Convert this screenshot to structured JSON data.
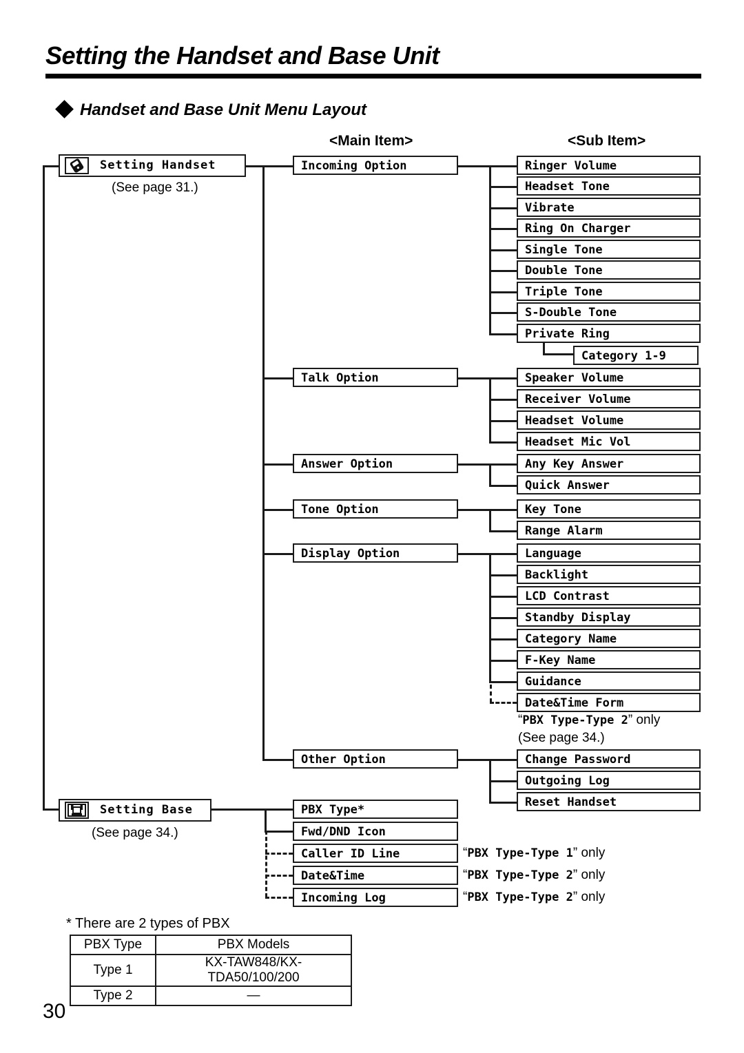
{
  "header": {
    "title": "Setting the Handset and Base Unit",
    "section_title": "Handset and Base Unit Menu Layout",
    "bullet_icon": "diamond-bullet"
  },
  "columns": {
    "main_item_header": "<Main Item>",
    "sub_item_header": "<Sub Item>"
  },
  "roots": [
    {
      "label": "Setting Handset",
      "icon": "handset-icon",
      "note": "(See page 31.)"
    },
    {
      "label": "Setting Base",
      "icon": "base-unit-icon",
      "note": "(See page 34.)"
    }
  ],
  "main_items": [
    {
      "label": "Incoming Option"
    },
    {
      "label": "Talk Option"
    },
    {
      "label": "Answer Option"
    },
    {
      "label": "Tone Option"
    },
    {
      "label": "Display Option"
    },
    {
      "label": "Other Option"
    }
  ],
  "sub_items": {
    "incoming_option": [
      "Ringer Volume",
      "Headset Tone",
      "Vibrate",
      "Ring On Charger",
      "Single Tone",
      "Double Tone",
      "Triple Tone",
      "S-Double Tone",
      "Private Ring"
    ],
    "private_ring_child": "Category 1-9",
    "talk_option": [
      "Speaker Volume",
      "Receiver Volume",
      "Headset Volume",
      "Headset Mic Vol"
    ],
    "answer_option": [
      "Any Key Answer",
      "Quick Answer"
    ],
    "tone_option": [
      "Key Tone",
      "Range Alarm"
    ],
    "display_option": [
      "Language",
      "Backlight",
      "LCD Contrast",
      "Standby Display",
      "Category Name",
      "F-Key Name",
      "Guidance",
      "Date&Time Form"
    ],
    "other_option": [
      "Change Password",
      "Outgoing Log",
      "Reset Handset"
    ]
  },
  "base_items": [
    {
      "label": "PBX Type*",
      "condition": ""
    },
    {
      "label": "Fwd/DND Icon",
      "condition": ""
    },
    {
      "label": "Caller ID Line",
      "condition_quote": "PBX Type-Type 1",
      "condition_tail": "only"
    },
    {
      "label": "Date&Time",
      "condition_quote": "PBX Type-Type 2",
      "condition_tail": "only"
    },
    {
      "label": "Incoming Log",
      "condition_quote": "PBX Type-Type 2",
      "condition_tail": "only"
    }
  ],
  "annotations": {
    "datetime_form_quote": "PBX Type-Type 2",
    "datetime_form_tail": "only",
    "datetime_form_page": "(See page 34.)"
  },
  "footer": {
    "table_note": "* There are 2 types of PBX",
    "table": {
      "headers": [
        "PBX Type",
        "PBX Models"
      ],
      "rows": [
        [
          "Type 1",
          "KX-TAW848/KX-TDA50/100/200"
        ],
        [
          "Type 2",
          "—"
        ]
      ]
    },
    "page_number": "30"
  }
}
